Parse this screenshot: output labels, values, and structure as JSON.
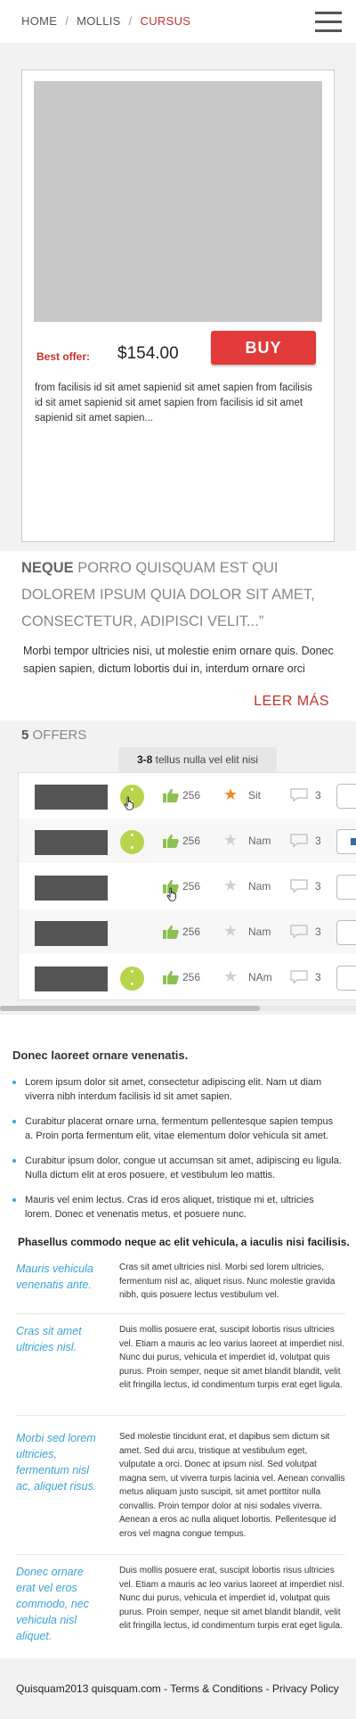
{
  "breadcrumb": {
    "home": "HOME",
    "mid": "MOLLIS",
    "current": "CURSUS",
    "separator": "/"
  },
  "product": {
    "best_offer_label": "Best offer:",
    "price": "$154.00",
    "buy_label": "BUY",
    "description": "from facilisis id sit amet sapienid sit amet sapien from facilisis id sit amet sapienid sit amet sapien from facilisis id sit amet sapienid sit amet sapien..."
  },
  "quote": {
    "lead": "NEQUE",
    "rest": " PORRO QUISQUAM EST QUI DOLOREM IPSUM QUIA DOLOR SIT AMET, CONSECTETUR, ADIPISCI VELIT...”",
    "body": "Morbi tempor ultricies nisi, ut molestie enim ornare quis. Donec sapien sapien, dictum lobortis dui in, interdum ornare orci",
    "more_label": "LEER MÁS"
  },
  "offers": {
    "count": "5",
    "title": "OFFERS",
    "tooltip_bold": "3-8",
    "tooltip_text": " tellus nulla vel elit nisi",
    "rows": [
      {
        "dot": true,
        "likes": "256",
        "star_on": true,
        "label": "Sit",
        "comments": "3",
        "checked": false
      },
      {
        "dot": true,
        "likes": "256",
        "star_on": false,
        "label": "Nam",
        "comments": "3",
        "checked": true
      },
      {
        "dot": false,
        "likes": "256",
        "star_on": false,
        "label": "Nam",
        "comments": "3",
        "checked": false
      },
      {
        "dot": false,
        "likes": "256",
        "star_on": false,
        "label": "Nam",
        "comments": "3",
        "checked": false
      },
      {
        "dot": true,
        "likes": "256",
        "star_on": false,
        "label": "NAm",
        "comments": "3",
        "checked": false
      }
    ]
  },
  "content": {
    "heading": "Donec laoreet ornare venenatis.",
    "bullets": [
      "Lorem ipsum dolor sit amet, consectetur adipiscing elit. Nam ut diam viverra nibh interdum facilisis id sit amet sapien.",
      "Curabitur placerat ornare urna, fermentum pellentesque sapien tempus a. Proin porta fermentum elit, vitae elementum dolor vehicula sit amet.",
      "Curabitur ipsum dolor, congue ut accumsan sit amet, adipiscing eu ligula. Nulla dictum elit at eros posuere, et vestibulum leo mattis.",
      "Mauris vel enim lectus. Cras id eros aliquet, tristique mi et, ultricies lorem. Donec et venenatis metus, et posuere nunc."
    ],
    "subheading": "Phasellus commodo neque ac elit vehicula, a iaculis nisi facilisis.",
    "definitions": [
      {
        "term": "Mauris vehicula venenatis ante.",
        "text": "Cras sit amet ultricies nisl. Morbi sed lorem ultricies, fermentum nisl ac, aliquet risus. Nunc molestie gravida nibh, quis posuere lectus vestibulum vel."
      },
      {
        "term": "Cras sit amet ultricies nisl.",
        "text": "Duis mollis posuere erat, suscipit lobortis risus ultricies vel. Etiam a mauris ac leo varius laoreet at imperdiet nisl. Nunc dui purus, vehicula et imperdiet id, volutpat quis purus. Proin semper, neque sit amet blandit blandit, velit elit fringilla lectus, id condimentum turpis erat eget ligula."
      },
      {
        "term": "Morbi sed lorem ultricies, fermentum nisl ac, aliquet risus.",
        "text": "Sed molestie tincidunt erat, et dapibus sem dictum sit amet. Sed dui arcu, tristique at vestibulum eget, vulputate a orci. Donec at ipsum nisl. Sed volutpat magna sem, ut viverra turpis lacinia vel. Aenean convallis metus aliquam justo suscipit, sit amet porttitor nulla convallis. Proin tempor dolor at nisi sodales viverra. Aenean a eros ac nulla aliquet lobortis. Pellentesque id eros vel magna congue tempus."
      },
      {
        "term": "Donec ornare erat vel eros commodo, nec vehicula nisl aliquet.",
        "text": "Duis mollis posuere erat, suscipit lobortis risus ultricies vel. Etiam a mauris ac leo varius laoreet at imperdiet nisl. Nunc dui purus, vehicula et imperdiet id, volutpat quis purus. Proin semper, neque sit amet blandit blandit, velit elit fringilla lectus, id condimentum turpis erat eget ligula."
      }
    ]
  },
  "footer": {
    "text": "Quisquam2013 quisquam.com - Terms & Conditions - Privacy Policy"
  },
  "colors": {
    "accent_red": "#c9302c",
    "buy_red": "#e23a3a",
    "link_blue": "#3aa3d6",
    "green": "#b7d44a",
    "star_orange": "#f08a24"
  }
}
